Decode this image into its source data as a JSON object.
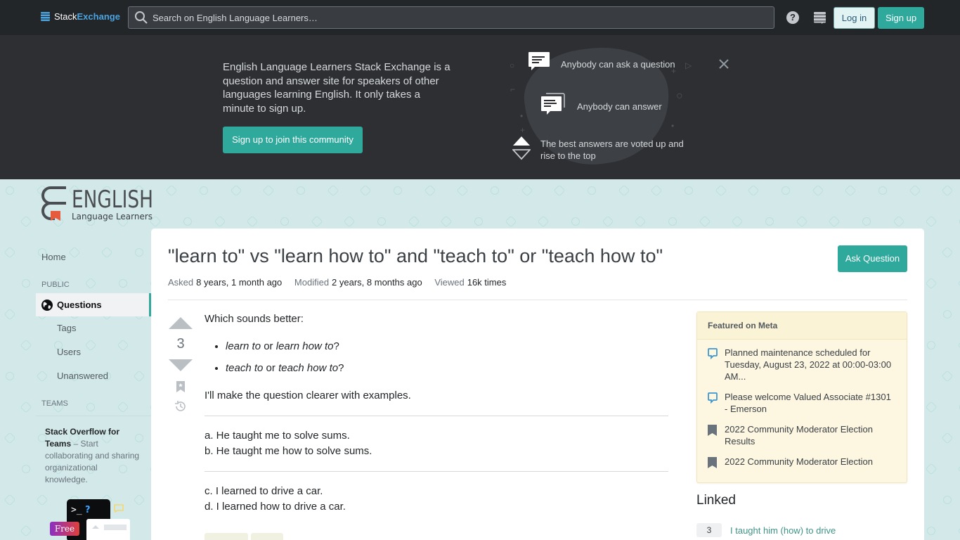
{
  "topbar": {
    "logo_part1": "Stack",
    "logo_part2": "Exchange",
    "search_placeholder": "Search on English Language Learners…",
    "help_glyph": "?",
    "login_label": "Log in",
    "signup_label": "Sign up"
  },
  "hero": {
    "description": "English Language Learners Stack Exchange is a question and answer site for speakers of other languages learning English. It only takes a minute to sign up.",
    "cta_label": "Sign up to join this community",
    "features": [
      {
        "icon": "chat-icon",
        "text": "Anybody can ask a question"
      },
      {
        "icon": "chat-stack-icon",
        "text": "Anybody can answer"
      },
      {
        "icon": "vote-arrows-icon",
        "text": "The best answers are voted up and rise to the top"
      }
    ]
  },
  "site": {
    "logo_title": "ENGLISH",
    "logo_subtitle": "Language Learners"
  },
  "leftnav": {
    "home": "Home",
    "public_label": "PUBLIC",
    "questions": "Questions",
    "tags": "Tags",
    "users": "Users",
    "unanswered": "Unanswered",
    "teams_label": "TEAMS",
    "teams_bold": "Stack Overflow for Teams",
    "teams_text": " – Start collaborating and sharing organizational knowledge.",
    "teams_badge": "Free",
    "teams_prompt": ">_?"
  },
  "question": {
    "title": "\"learn to\" vs \"learn how to\" and \"teach to\" or \"teach how to\"",
    "ask_button": "Ask Question",
    "asked_label": "Asked",
    "asked_value": "8 years, 1 month ago",
    "modified_label": "Modified",
    "modified_value": "2 years, 8 months ago",
    "viewed_label": "Viewed",
    "viewed_value": "16k times",
    "votes": "3",
    "body": {
      "intro": "Which sounds better:",
      "bullets": [
        {
          "a": "learn to",
          "or": " or ",
          "b": "learn how to",
          "end": "?"
        },
        {
          "a": "teach to",
          "or": " or ",
          "b": "teach how to",
          "end": "?"
        }
      ],
      "clarify": "I'll make the question clearer with examples.",
      "ex_a": "a. He taught me to solve sums.",
      "ex_b": "b. He taught me how to solve sums.",
      "ex_c": "c. I learned to drive a car.",
      "ex_d": "d. I learned how to drive a car."
    }
  },
  "sidebar": {
    "featured_title": "Featured on Meta",
    "featured_items": [
      {
        "icon": "meta-chat-icon",
        "text": "Planned maintenance scheduled for Tuesday, August 23, 2022 at 00:00-03:00 AM..."
      },
      {
        "icon": "meta-chat-icon",
        "text": "Please welcome Valued Associate #1301 - Emerson"
      },
      {
        "icon": "bookmark-flag-icon",
        "text": "2022 Community Moderator Election Results"
      },
      {
        "icon": "bookmark-flag-icon",
        "text": "2022 Community Moderator Election"
      }
    ],
    "linked_title": "Linked",
    "linked_items": [
      {
        "count": "3",
        "text": "I taught him (how) to drive"
      }
    ]
  },
  "colors": {
    "accent": "#2fa99c",
    "topbar": "#232629",
    "hero": "#2d2f33",
    "page_bg": "#d3e9e9",
    "featured_bg": "#fdf7e2"
  }
}
